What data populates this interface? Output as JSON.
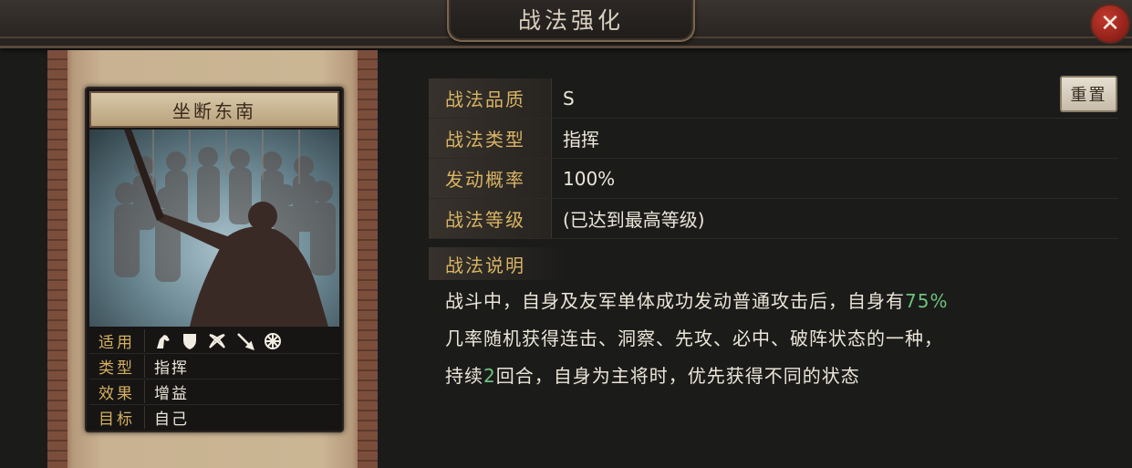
{
  "header": {
    "title": "战法强化"
  },
  "skill_card": {
    "name": "坐断东南",
    "info": [
      {
        "key": "适用",
        "value": ""
      },
      {
        "key": "类型",
        "value": "指挥"
      },
      {
        "key": "效果",
        "value": "增益"
      },
      {
        "key": "目标",
        "value": "自己"
      }
    ],
    "applicable_icons": [
      "cavalry-icon",
      "shield-icon",
      "crossed-bows-icon",
      "spear-icon",
      "wheel-icon"
    ]
  },
  "details": {
    "quality_label": "战法品质",
    "quality_value": "S",
    "type_label": "战法类型",
    "type_value": "指挥",
    "rate_label": "发动概率",
    "rate_value": "100%",
    "level_label": "战法等级",
    "level_value": "(已达到最高等级)",
    "reset_label": "重置"
  },
  "description": {
    "label": "战法说明",
    "part1": "战斗中，自身及友军单体成功发动普通攻击后，自身有",
    "pct": "75%",
    "part2": "几率随机获得连击、洞察、先攻、必中、破阵状态的一种，",
    "part3": "持续",
    "rounds": "2",
    "part4": "回合，自身为主将时，优先获得不同的状态"
  },
  "colors": {
    "highlight": "#6dc27b",
    "label_gold": "#d8b464",
    "close_red": "#c23a2e"
  }
}
